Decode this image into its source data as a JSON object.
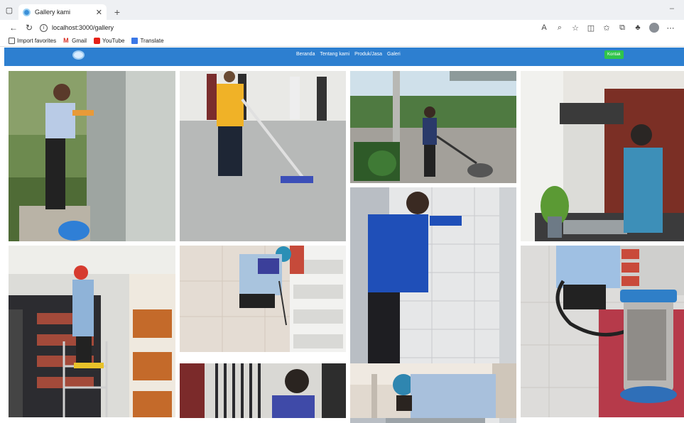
{
  "browser": {
    "tab_title": "Gallery kami",
    "url": "localhost:3000/gallery",
    "favorites": [
      {
        "label": "Import favorites",
        "icon": "import-icon"
      },
      {
        "label": "Gmail",
        "icon": "gmail-icon"
      },
      {
        "label": "YouTube",
        "icon": "youtube-icon"
      },
      {
        "label": "Translate",
        "icon": "translate-icon"
      }
    ]
  },
  "navbar": {
    "links": [
      "Beranda",
      "Tentang kami",
      "Produk/Jasa",
      "Galeri"
    ],
    "contact_label": "Kontak",
    "color": "#2d7fd0",
    "contact_color": "#2fc44b"
  },
  "gallery": {
    "photos": [
      {
        "id": "cleaning-pillar-photo"
      },
      {
        "id": "mopping-floor-photo"
      },
      {
        "id": "floor-polisher-photo"
      },
      {
        "id": "cleaning-kitchen-photo"
      },
      {
        "id": "cleaning-tile-wall-photo"
      },
      {
        "id": "cleaning-shelves-ladder-photo"
      },
      {
        "id": "cleaning-store-floor-photo"
      },
      {
        "id": "vacuum-cleaner-photo"
      },
      {
        "id": "cleaning-railing-photo"
      },
      {
        "id": "cleaning-low-wall-photo"
      }
    ]
  }
}
